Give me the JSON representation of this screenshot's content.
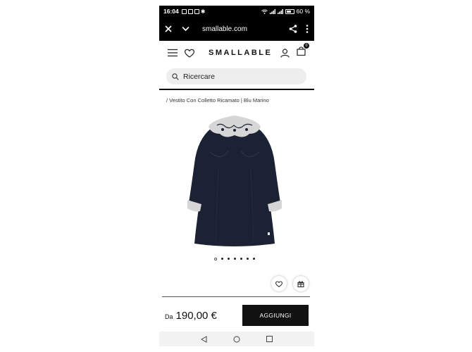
{
  "status_bar": {
    "time": "16:04",
    "battery": "60 %"
  },
  "browser": {
    "url": "smallable.com"
  },
  "header": {
    "brand": "SMALLABLE",
    "cart_count": "0"
  },
  "search": {
    "placeholder": "Ricercare"
  },
  "breadcrumb": "/ Vestito Con Colletto Ricamato | Blu Marino",
  "gallery": {
    "dots": 7,
    "active_index": 0
  },
  "price": {
    "prefix": "Da",
    "value": "190,00 €"
  },
  "actions": {
    "add_label": "AGGIUNGI"
  },
  "icons": {
    "close": "close-icon",
    "chevron": "chevron-down-icon",
    "share": "share-icon",
    "menu": "more-vert-icon",
    "hamburger": "hamburger-menu-icon",
    "heart": "heart-icon",
    "user": "user-icon",
    "cart": "cart-icon",
    "search": "search-icon",
    "gift": "gift-icon"
  },
  "colors": {
    "dress": "#1b2233",
    "lace": "#d6d6d6",
    "button_bg": "#111111"
  }
}
